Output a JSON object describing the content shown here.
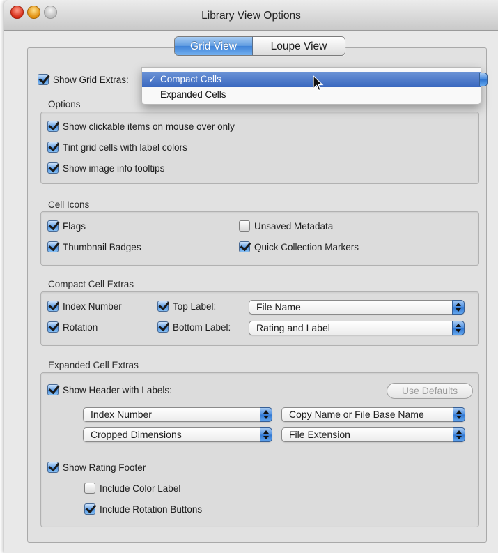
{
  "window": {
    "title": "Library View Options"
  },
  "view_tabs": {
    "grid": "Grid View",
    "loupe": "Loupe View",
    "selected": "Grid View"
  },
  "grid_extras": {
    "checkbox_label": "Show Grid Extras:",
    "checked": true,
    "menu_options": [
      "Compact Cells",
      "Expanded Cells"
    ],
    "selected": "Compact Cells"
  },
  "options": {
    "title": "Options",
    "items": [
      {
        "label": "Show clickable items on mouse over only",
        "checked": true
      },
      {
        "label": "Tint grid cells with label colors",
        "checked": true
      },
      {
        "label": "Show image info tooltips",
        "checked": true
      }
    ]
  },
  "cell_icons": {
    "title": "Cell Icons",
    "items": [
      {
        "label": "Flags",
        "checked": true
      },
      {
        "label": "Unsaved Metadata",
        "checked": false
      },
      {
        "label": "Thumbnail Badges",
        "checked": true
      },
      {
        "label": "Quick Collection Markers",
        "checked": true
      }
    ]
  },
  "compact_extras": {
    "title": "Compact Cell Extras",
    "index_number": {
      "label": "Index Number",
      "checked": true
    },
    "rotation": {
      "label": "Rotation",
      "checked": true
    },
    "top_label": {
      "label": "Top Label:",
      "checked": true,
      "value": "File Name"
    },
    "bottom_label": {
      "label": "Bottom Label:",
      "checked": true,
      "value": "Rating and Label"
    }
  },
  "expanded_extras": {
    "title": "Expanded Cell Extras",
    "show_header": {
      "label": "Show Header with Labels:",
      "checked": true
    },
    "use_defaults": "Use Defaults",
    "header_fields": [
      "Index Number",
      "Copy Name or File Base Name",
      "Cropped Dimensions",
      "File Extension"
    ],
    "show_rating_footer": {
      "label": "Show Rating Footer",
      "checked": true
    },
    "include_color_label": {
      "label": "Include Color Label",
      "checked": false
    },
    "include_rotation_buttons": {
      "label": "Include Rotation Buttons",
      "checked": true
    }
  },
  "colors": {
    "accent": "#3f83d8",
    "menu_highlight": "#3a68c0",
    "window_bg": "#e9e9e9"
  }
}
